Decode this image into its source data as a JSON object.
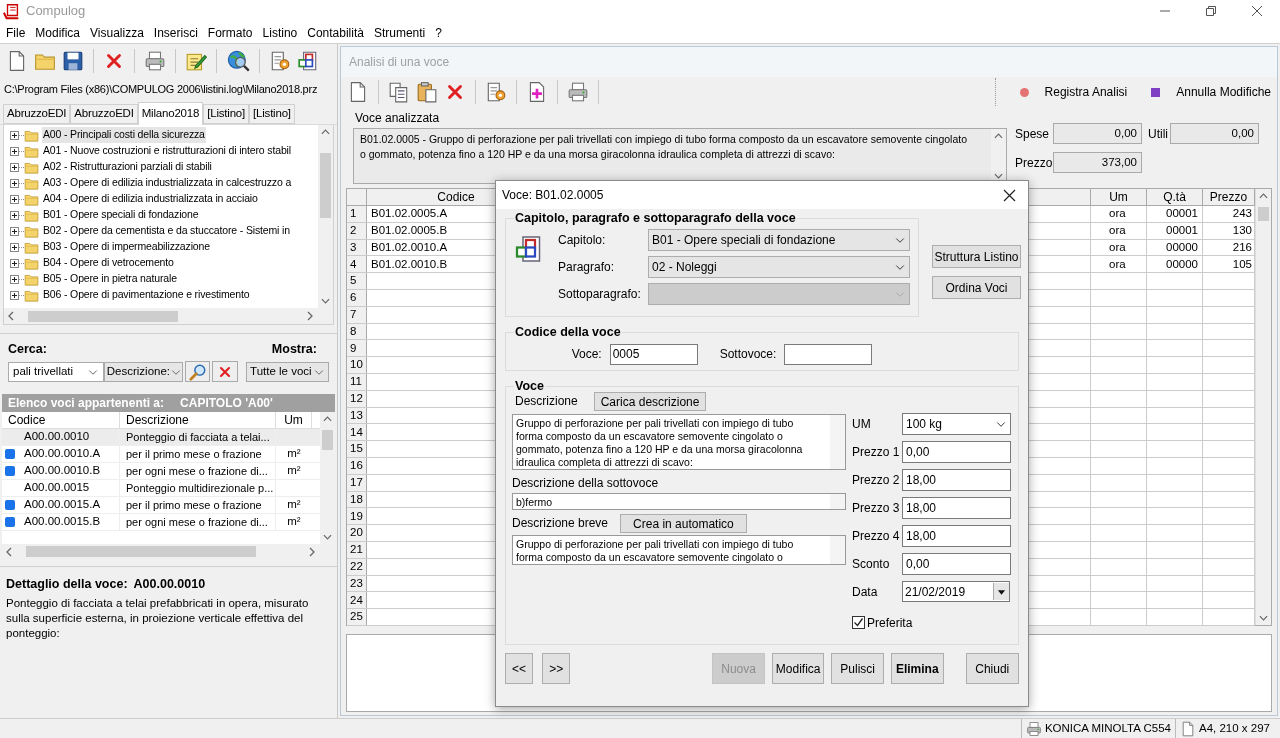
{
  "window": {
    "title": "Compulog"
  },
  "menu": [
    "File",
    "Modifica",
    "Visualizza",
    "Inserisci",
    "Formato",
    "Listino",
    "Contabilità",
    "Strumenti",
    "?"
  ],
  "listino": {
    "path": "C:\\Program Files (x86)\\COMPULOG 2006\\listini.log\\Milano2018.prz",
    "tabs": [
      {
        "label": "AbruzzoEDI",
        "selected": false
      },
      {
        "label": "AbruzzoEDI",
        "selected": false
      },
      {
        "label": "Milano2018",
        "selected": true
      },
      {
        "label": "[Listino]",
        "selected": false
      },
      {
        "label": "[Listino]",
        "selected": false
      }
    ],
    "tree": [
      {
        "label": "A00 - Principali costi della sicurezza",
        "expanded": false,
        "selected": true
      },
      {
        "label": "A01 - Nuove costruzioni e ristrutturazioni di intero stabil",
        "expanded": false,
        "selected": false
      },
      {
        "label": "A02 - Ristrutturazioni parziali di stabili",
        "expanded": false,
        "selected": false
      },
      {
        "label": "A03 - Opere di edilizia industrializzata in calcestruzzo a",
        "expanded": false,
        "selected": false
      },
      {
        "label": "A04 - Opere di edilizia industrializzata in acciaio",
        "expanded": false,
        "selected": false
      },
      {
        "label": "B01 - Opere speciali di fondazione",
        "expanded": false,
        "selected": false
      },
      {
        "label": "B02 - Opere da cementista e da stuccatore - Sistemi in",
        "expanded": false,
        "selected": false
      },
      {
        "label": "B03 - Opere di impermeabilizzazione",
        "expanded": false,
        "selected": false
      },
      {
        "label": "B04 - Opere di vetrocemento",
        "expanded": false,
        "selected": false
      },
      {
        "label": "B05 - Opere in pietra naturale",
        "expanded": false,
        "selected": false
      },
      {
        "label": "B06 - Opere di pavimentazione e rivestimento",
        "expanded": false,
        "selected": false
      }
    ]
  },
  "search": {
    "label": "Cerca:",
    "value": "pali trivellati",
    "field": "Descrizione:",
    "show_label": "Mostra:",
    "show_value": "Tutte le voci"
  },
  "items_list": {
    "heading": "Elenco voci appartenenti a:",
    "chapter": "CAPITOLO 'A00'",
    "columns": [
      "Codice",
      "Descrizione",
      "Um"
    ],
    "rows": [
      {
        "marked": false,
        "selected": true,
        "code": "A00.00.0010",
        "description": "Ponteggio di facciata a telai..."
      },
      {
        "marked": true,
        "selected": false,
        "code": "A00.00.0010.A",
        "description": "per il primo mese o frazione",
        "unit": "m²"
      },
      {
        "marked": true,
        "selected": false,
        "code": "A00.00.0010.B",
        "description": "per ogni mese o frazione di...",
        "unit": "m²"
      },
      {
        "marked": false,
        "selected": false,
        "code": "A00.00.0015",
        "description": "Ponteggio multidirezionale p..."
      },
      {
        "marked": true,
        "selected": false,
        "code": "A00.00.0015.A",
        "description": "per il primo mese o frazione",
        "unit": "m²"
      },
      {
        "marked": true,
        "selected": false,
        "code": "A00.00.0015.B",
        "description": "per ogni mese o frazione di...",
        "unit": "m²"
      }
    ]
  },
  "detail": {
    "heading": "Dettaglio della voce:",
    "code": "A00.00.0010",
    "text": "Ponteggio di facciata a telai prefabbricati in opera, misurato sulla superficie esterna, in proiezione verticale effettiva del ponteggio:"
  },
  "analysis": {
    "title": "Analisi di una voce",
    "actions": [
      {
        "label": "Registra Analisi",
        "color": "#e57373"
      },
      {
        "label": "Annulla Modifiche",
        "color": "#7e3fc4"
      }
    ],
    "item_label": "Voce analizzata",
    "item_text": "B01.02.0005 - Gruppo di perforazione per pali trivellati con impiego di tubo forma composto da un escavatore semovente cingolato\no gommato, potenza fino a 120 HP e da una morsa giracolonna idraulica completa di attrezzi di scavo:",
    "totals": [
      {
        "label": "Spese",
        "value": "0,00"
      },
      {
        "label": "Utili",
        "value": "0,00"
      },
      {
        "label": "Prezzo",
        "value": "373,00"
      }
    ],
    "grid": {
      "columns": [
        "Codice",
        "Um",
        "Q.tà",
        "Prezzo"
      ],
      "rows": [
        {
          "number": "1",
          "cells": [
            "B01.02.0005.A",
            "ora",
            "00001",
            "243"
          ]
        },
        {
          "number": "2",
          "cells": [
            "B01.02.0005.B",
            "ora",
            "00001",
            "130"
          ]
        },
        {
          "number": "3",
          "cells": [
            "B01.02.0010.A",
            "ora",
            "00000",
            "216"
          ]
        },
        {
          "number": "4",
          "cells": [
            "B01.02.0010.B",
            "ora",
            "00000",
            "105"
          ]
        },
        {
          "number": "5"
        },
        {
          "number": "6"
        },
        {
          "number": "7"
        },
        {
          "number": "8"
        },
        {
          "number": "9"
        },
        {
          "number": "10"
        },
        {
          "number": "11"
        },
        {
          "number": "12"
        },
        {
          "number": "13"
        },
        {
          "number": "14"
        },
        {
          "number": "15"
        },
        {
          "number": "16"
        },
        {
          "number": "17"
        },
        {
          "number": "18"
        },
        {
          "number": "19"
        },
        {
          "number": "20"
        },
        {
          "number": "21"
        },
        {
          "number": "22"
        },
        {
          "number": "23"
        },
        {
          "number": "24"
        },
        {
          "number": "25"
        }
      ]
    }
  },
  "dialog": {
    "title": "Voce: B01.02.0005",
    "chapter_group": {
      "title": "Capitolo, paragrafo e sottoparagrafo della voce",
      "fields": [
        {
          "label": "Capitolo:",
          "value": "B01 - Opere speciali di fondazione",
          "disabled": false
        },
        {
          "label": "Paragrafo:",
          "value": "02 - Noleggi",
          "disabled": false
        },
        {
          "label": "Sottoparagrafo:",
          "disabled": true
        }
      ],
      "buttons": [
        "Struttura Listino",
        "Ordina Voci"
      ]
    },
    "code_group": {
      "title": "Codice della voce",
      "fields": [
        {
          "label": "Voce:",
          "value": "0005"
        },
        {
          "label": "Sottovoce:"
        }
      ]
    },
    "item_group": {
      "title": "Voce",
      "description_label": "Descrizione",
      "load_button": "Carica descrizione",
      "description": "Gruppo di perforazione per pali trivellati con impiego di tubo\nforma composto da un escavatore semovente cingolato o\ngommato, potenza fino a 120 HP e da una morsa giracolonna\nidraulica completa di attrezzi di scavo:",
      "sub_label": "Descrizione della sottovoce",
      "sub_description": "b)fermo",
      "short_label": "Descrizione breve",
      "auto_button": "Crea in automatico",
      "short_description": "Gruppo di perforazione per pali trivellati con impiego di tubo\nforma composto da un escavatore semovente cingolato o",
      "fields": [
        {
          "kind": "dropdown",
          "label": "UM",
          "value": "100 kg"
        },
        {
          "kind": "text",
          "label": "Prezzo 1",
          "value": "0,00"
        },
        {
          "kind": "text",
          "label": "Prezzo 2",
          "value": "18,00"
        },
        {
          "kind": "text",
          "label": "Prezzo 3",
          "value": "18,00"
        },
        {
          "kind": "text",
          "label": "Prezzo 4",
          "value": "18,00"
        },
        {
          "kind": "text",
          "label": "Sconto",
          "value": "0,00"
        },
        {
          "kind": "date",
          "label": "Data",
          "value": "21/02/2019"
        }
      ],
      "favorite": {
        "label": "Preferita",
        "checked": true
      }
    },
    "buttons": [
      {
        "label": "<<",
        "disabled": false,
        "default": false
      },
      {
        "label": ">>",
        "disabled": false,
        "default": false
      },
      {
        "label": "Nuova",
        "disabled": true,
        "default": false
      },
      {
        "label": "Modifica",
        "disabled": false,
        "default": false
      },
      {
        "label": "Pulisci",
        "disabled": false,
        "default": false
      },
      {
        "label": "Elimina",
        "disabled": false,
        "default": true
      },
      {
        "label": "Chiudi",
        "disabled": false,
        "default": false
      }
    ]
  },
  "status_bar": {
    "printer": "KONICA MINOLTA C554",
    "paper": "A4, 210 x 297"
  }
}
